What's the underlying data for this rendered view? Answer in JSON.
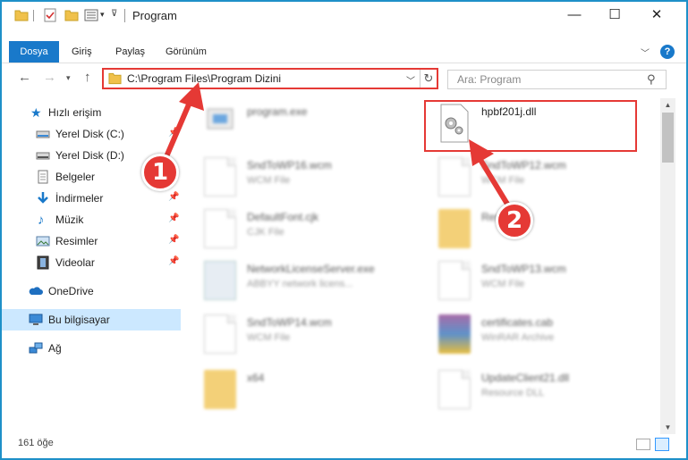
{
  "window": {
    "title": "Program",
    "buttons": {
      "minimize": "—",
      "maximize": "☐",
      "close": "✕"
    }
  },
  "ribbon": {
    "tabs": [
      "Dosya",
      "Giriş",
      "Paylaş",
      "Görünüm"
    ],
    "expand_icon": "chevron-down",
    "help": "?"
  },
  "nav": {
    "back": "←",
    "forward": "→",
    "up": "↑",
    "address": "C:\\Program Files\\Program Dizini",
    "search_placeholder": "Ara: Program"
  },
  "sidebar": {
    "items": [
      {
        "label": "Hızlı erişim",
        "icon": "star-icon"
      },
      {
        "label": "Yerel Disk (C:)",
        "icon": "drive-icon",
        "pinned": true
      },
      {
        "label": "Yerel Disk (D:)",
        "icon": "drive-icon",
        "pinned": true
      },
      {
        "label": "Belgeler",
        "icon": "documents-icon",
        "pinned": true
      },
      {
        "label": "İndirmeler",
        "icon": "download-icon",
        "pinned": true
      },
      {
        "label": "Müzik",
        "icon": "music-icon",
        "pinned": true
      },
      {
        "label": "Resimler",
        "icon": "pictures-icon",
        "pinned": true
      },
      {
        "label": "Videolar",
        "icon": "videos-icon",
        "pinned": true
      },
      {
        "label": "OneDrive",
        "icon": "cloud-icon"
      },
      {
        "label": "Bu bilgisayar",
        "icon": "computer-icon",
        "selected": true
      },
      {
        "label": "Ağ",
        "icon": "network-icon"
      }
    ]
  },
  "files": [
    {
      "name": "program.exe",
      "type": "",
      "icon": "exe-icon"
    },
    {
      "name": "hpbf201j.dll",
      "type": "",
      "icon": "dll-icon",
      "highlighted": true
    },
    {
      "name": "SndToWP16.wcm",
      "type": "WCM File",
      "icon": "document-icon"
    },
    {
      "name": "SndToWP12.wcm",
      "type": "WCM File",
      "icon": "document-icon"
    },
    {
      "name": "DefaultFont.cjk",
      "type": "CJK File",
      "icon": "document-icon"
    },
    {
      "name": "Resources",
      "type": "",
      "icon": "folder-icon"
    },
    {
      "name": "NetworkLicenseServer.exe",
      "type": "ABBYY network licens...",
      "icon": "window-icon"
    },
    {
      "name": "SndToWP13.wcm",
      "type": "WCM File",
      "icon": "document-icon"
    },
    {
      "name": "SndToWP14.wcm",
      "type": "WCM File",
      "icon": "document-icon"
    },
    {
      "name": "certificates.cab",
      "type": "WinRAR Archive",
      "icon": "archive-icon"
    },
    {
      "name": "x64",
      "type": "",
      "icon": "folder-icon"
    },
    {
      "name": "UpdateClient21.dll",
      "type": "Resource DLL",
      "icon": "document-icon"
    }
  ],
  "status": {
    "count": "161 öğe"
  },
  "annotations": {
    "step1": "1",
    "step2": "2",
    "color": "#e53935"
  }
}
